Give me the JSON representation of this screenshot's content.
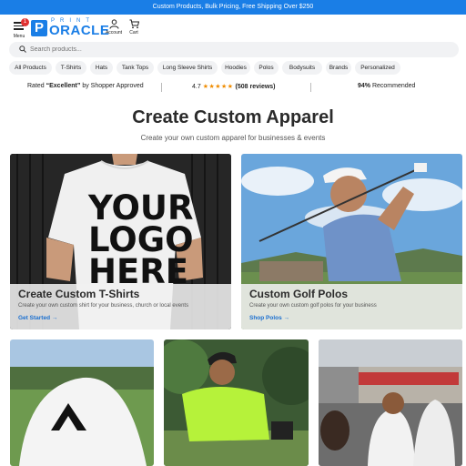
{
  "promo": {
    "text": "Custom Products, Bulk Pricing, Free Shipping Over $250"
  },
  "header": {
    "menu_label": "Menu",
    "menu_badge": "1",
    "logo_print": "PRINT",
    "logo_oracle": "ORACLE",
    "account_label": "Account",
    "cart_label": "Cart"
  },
  "search": {
    "placeholder": "Search products..."
  },
  "categories": [
    "All Products",
    "T-Shirts",
    "Hats",
    "Tank Tops",
    "Long Sleeve Shirts",
    "Hoodies",
    "Polos",
    "Bodysuits",
    "Brands",
    "Personalized"
  ],
  "trust": {
    "rated_prefix": "Rated ",
    "rated_word": "“Excellent”",
    "rated_suffix": " by Shopper Approved",
    "rating": "4.7",
    "stars": "★★★★★",
    "reviews": "(508 reviews)",
    "recommended_pct": "94%",
    "recommended_text": " Recommended"
  },
  "page": {
    "title": "Create Custom Apparel",
    "subtitle": "Create your own custom apparel for businesses & events"
  },
  "cards": [
    {
      "title": "Create Custom T-Shirts",
      "desc": "Create your own custom shirt for your business, church or local events",
      "link": "Get Started →",
      "shirt_text": [
        "YOUR",
        "LOGO",
        "HERE"
      ]
    },
    {
      "title": "Custom Golf Polos",
      "desc": "Create your own custom golf polos for your business",
      "link": "Shop Polos →"
    }
  ],
  "colors": {
    "brand": "#1a7ee6",
    "link": "#1a6fd0",
    "star": "#f08c00",
    "badge": "#e03131"
  }
}
